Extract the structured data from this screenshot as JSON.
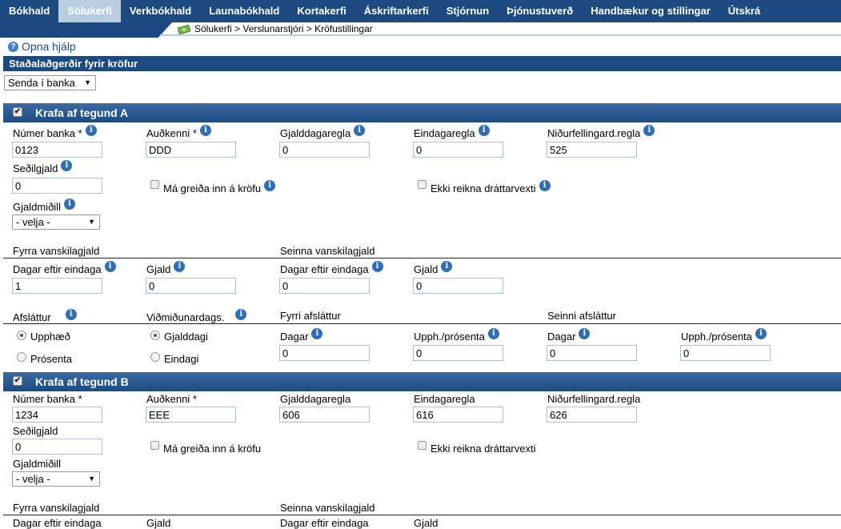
{
  "nav": {
    "tabs": [
      "Bókhald",
      "Sölukerfi",
      "Verkbókhald",
      "Launabókhald",
      "Kortakerfi",
      "Áskriftarkerfi",
      "Stjórnun",
      "Þjónustuverð",
      "Handbækur og stillingar",
      "Útskrá"
    ],
    "active_index": 1
  },
  "breadcrumb": "Sölukerfi > Verslunarstjóri > Kröfustillingar",
  "help_link": "Opna hjálp",
  "section_title": "Staðalaðgerðir fyrir kröfur",
  "action_select": "Senda í banka",
  "krafa_a": {
    "title": "Krafa af tegund A",
    "checked": true,
    "numer_banka_label": "Númer banka *",
    "numer_banka": "0123",
    "audkenni_label": "Auðkenni *",
    "audkenni": "DDD",
    "gjalddagaregla_label": "Gjalddagaregla",
    "gjalddagaregla": "0",
    "eindagaregla_label": "Eindagaregla",
    "eindagaregla": "0",
    "nidurfelling_label": "Niðurfellingard.regla",
    "nidurfelling": "525",
    "sedilgjald_label": "Seðilgjald",
    "sedilgjald": "0",
    "ma_greida_label": "Má greiða inn á kröfu",
    "ekki_reikna_label": "Ekki reikna dráttarvexti",
    "gjaldmidill_label": "Gjaldmiðill",
    "gjaldmidill": "- velja -",
    "fyrra_label": "Fyrra vanskilagjald",
    "seinna_label": "Seinna vanskilagjald",
    "dagar_eftir_label": "Dagar eftir eindaga",
    "gjald_label": "Gjald",
    "fyrra_dagar": "1",
    "fyrra_gjald": "0",
    "seinna_dagar": "0",
    "seinna_gjald": "0",
    "afslattur_label": "Afsláttur",
    "vidmidun_label": "Viðmiðunardags.",
    "fyrri_afsl_label": "Fyrri afsláttur",
    "seinni_afsl_label": "Seinni afsláttur",
    "upphaed_label": "Upphæð",
    "prosenta_label": "Prósenta",
    "gjalddagi_label": "Gjalddagi",
    "eindagi_label": "Eindagi",
    "dagar_label": "Dagar",
    "upph_pros_label": "Upph./prósenta",
    "fyrri_dagar": "0",
    "fyrri_upph": "0",
    "seinni_dagar": "0",
    "seinni_upph": "0"
  },
  "krafa_b": {
    "title": "Krafa af tegund B",
    "checked": true,
    "numer_banka_label": "Númer banka *",
    "numer_banka": "1234",
    "audkenni_label": "Auðkenni *",
    "audkenni": "EEE",
    "gjalddagaregla_label": "Gjalddagaregla",
    "gjalddagaregla": "606",
    "eindagaregla_label": "Eindagaregla",
    "eindagaregla": "616",
    "nidurfelling_label": "Niðurfellingard.regla",
    "nidurfelling": "626",
    "sedilgjald_label": "Seðilgjald",
    "sedilgjald": "0",
    "ma_greida_label": "Má greiða inn á kröfu",
    "ekki_reikna_label": "Ekki reikna dráttarvexti",
    "gjaldmidill_label": "Gjaldmiðill",
    "gjaldmidill": "- velja -",
    "fyrra_label": "Fyrra vanskilagjald",
    "seinna_label": "Seinna vanskilagjald",
    "dagar_eftir_label": "Dagar eftir eindaga",
    "gjald_label": "Gjald"
  },
  "colors": {
    "nav_bg": "#1c4a80",
    "active_tab": "#b9cde0",
    "info_icon": "#2e6db8",
    "link": "#1c4a9e"
  }
}
